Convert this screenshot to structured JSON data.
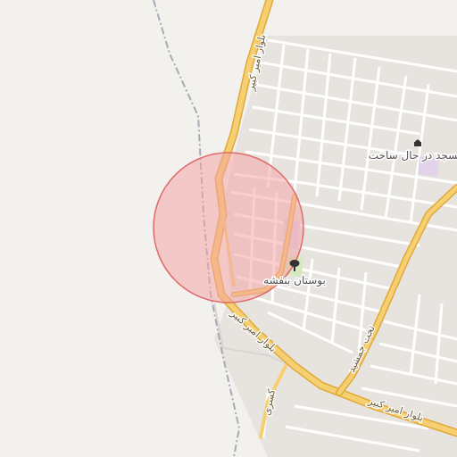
{
  "map": {
    "colors": {
      "background": "#f3f1ee",
      "block": "#e7e4df",
      "street": "#ffffff",
      "main_road": "#f6cf70",
      "main_road_casing": "#e0a93a",
      "railway": "#a9a9b5",
      "park": "#d6e8c0",
      "highlight_fill": "#f4a6a6",
      "highlight_stroke": "#e06a6a",
      "poi_purple": "#e3d3ea"
    },
    "labels": {
      "boulevard_north": "بلوار امیر کبیر",
      "boulevard_south": "بلوار امیر کبیر",
      "boulevard_east": "بلوار امیر کبیر",
      "street_takht": "تخت جمشید",
      "street_kasra": "کسری",
      "park_name": "بوستان بنفشه",
      "mosque_name": "مسجد در حال ساخت"
    },
    "icons": {
      "park": "tree-icon",
      "mosque": "mosque-icon"
    }
  }
}
